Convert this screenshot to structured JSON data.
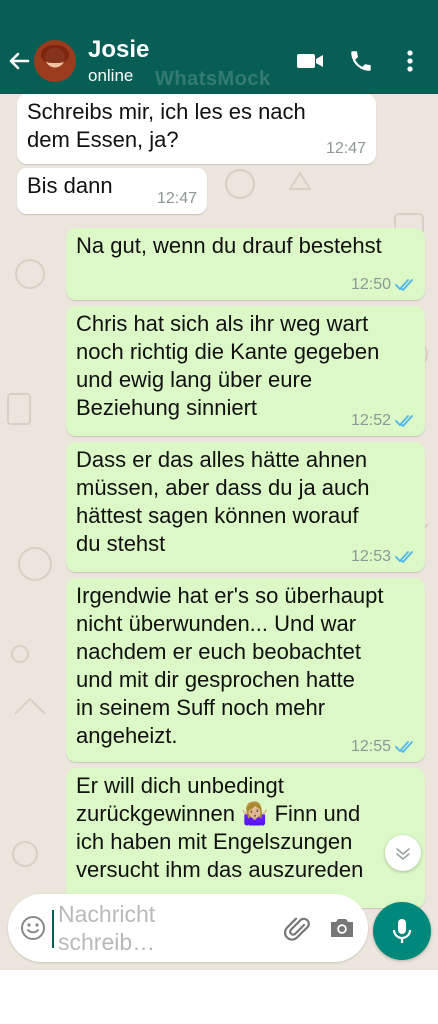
{
  "header": {
    "contact_name": "Josie",
    "contact_status": "online",
    "watermark": "WhatsMock"
  },
  "messages": [
    {
      "direction": "in",
      "text": "Schreibs mir, ich les es nach\ndem Essen, ja?",
      "time": "12:47"
    },
    {
      "direction": "in",
      "text": "Bis dann",
      "time": "12:47"
    },
    {
      "direction": "out",
      "text": "Na gut, wenn du drauf bestehst",
      "time": "12:50",
      "read": true
    },
    {
      "direction": "out",
      "text": "Chris hat sich als ihr weg wart\nnoch richtig die Kante gegeben\nund ewig lang über eure\nBeziehung sinniert",
      "time": "12:52",
      "read": true
    },
    {
      "direction": "out",
      "text": "Dass er das alles hätte ahnen\nmüssen, aber dass du ja auch\nhättest sagen können worauf\ndu stehst",
      "time": "12:53",
      "read": true
    },
    {
      "direction": "out",
      "text": "Irgendwie hat er's so überhaupt\nnicht überwunden... Und war\nnachdem er euch beobachtet\nund mit dir gesprochen hatte\nin seinem Suff noch mehr\nangeheizt.",
      "time": "12:55",
      "read": true
    },
    {
      "direction": "out",
      "text": "Er will dich unbedingt\nzurückgewinnen 🤷🏼‍♀️ Finn und\nich haben mit Engelszungen\nversucht ihm das auszureden",
      "time": "",
      "read": false
    }
  ],
  "composer": {
    "placeholder": "Nachricht\nschreib…"
  },
  "colors": {
    "header": "#075e54",
    "chat_background": "#ece5dd",
    "outgoing_bubble": "#dcf8c6",
    "incoming_bubble": "#ffffff",
    "read_ticks": "#4fb6ec",
    "mic_button": "#00897b"
  },
  "icons": [
    "back-arrow-icon",
    "video-call-icon",
    "phone-icon",
    "more-vert-icon",
    "emoji-icon",
    "attach-icon",
    "camera-icon",
    "mic-icon",
    "chevron-down-icon",
    "double-check-icon"
  ]
}
